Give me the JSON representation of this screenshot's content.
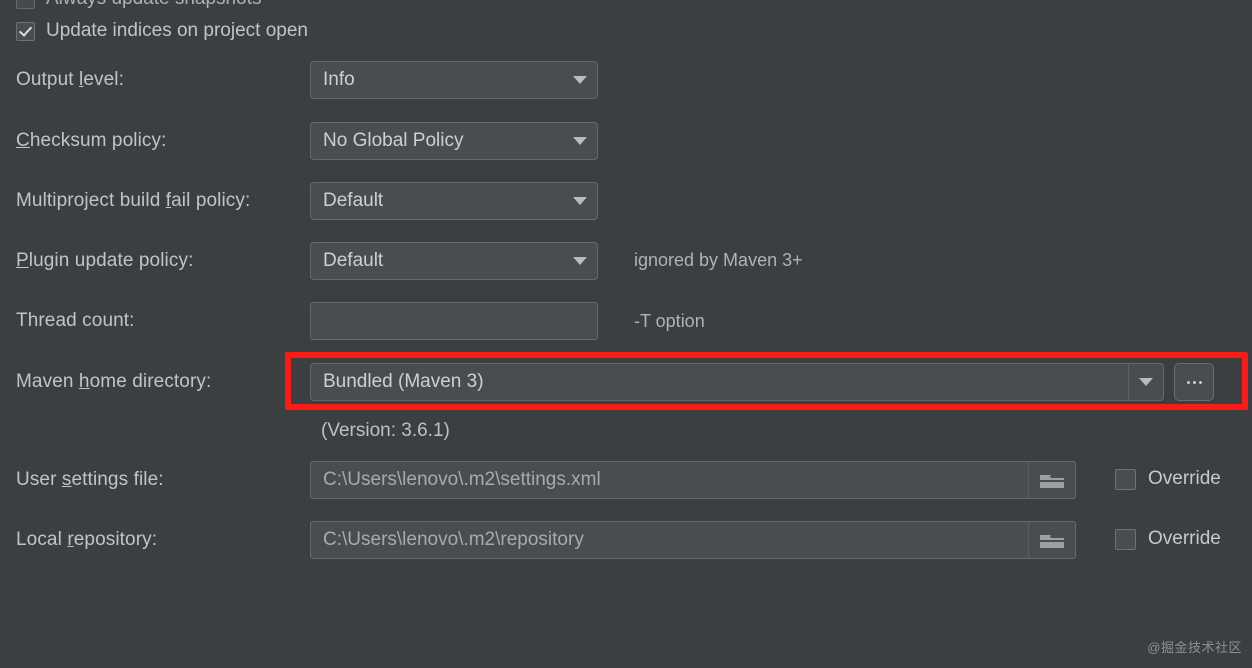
{
  "theme": {
    "background": "#3c3f41",
    "field_background": "#4a4d4f",
    "border": "#65696b",
    "text": "#c3c3c3",
    "muted_text": "#a9a9a9",
    "highlight": "#fc1a15"
  },
  "clipped_top_row": {
    "label": "Always update snapshots",
    "checked": false
  },
  "checkbox_row": {
    "label_before": "Update indices on project open",
    "label": "Update indices on project open",
    "checked": true,
    "icon": "checkbox-checked-icon"
  },
  "rows": [
    {
      "label_prefix": "Output ",
      "label_mnemonic": "l",
      "label_suffix": "evel:",
      "control": "combo",
      "value": "Info",
      "hint": ""
    },
    {
      "label_prefix": "",
      "label_mnemonic": "C",
      "label_suffix": "hecksum policy:",
      "control": "combo",
      "value": "No Global Policy",
      "hint": ""
    },
    {
      "label_prefix": "Multiproject build ",
      "label_mnemonic": "f",
      "label_suffix": "ail policy:",
      "control": "combo",
      "value": "Default",
      "hint": ""
    },
    {
      "label_prefix": "",
      "label_mnemonic": "P",
      "label_suffix": "lugin update policy:",
      "control": "combo",
      "value": "Default",
      "hint": "ignored by Maven 3+"
    },
    {
      "label_prefix": "Thread count:",
      "label_mnemonic": "",
      "label_suffix": "",
      "control": "text",
      "value": "",
      "hint": "-T option"
    }
  ],
  "maven_home": {
    "label_prefix": "Maven ",
    "label_mnemonic": "h",
    "label_suffix": "ome directory:",
    "value": "Bundled (Maven 3)",
    "caret_icon": "chevron-down-icon",
    "browse_label": "...",
    "browse_icon": "ellipsis-icon",
    "version_note": "(Version: 3.6.1)",
    "highlighted": true
  },
  "path_rows": [
    {
      "label_prefix": "User ",
      "label_mnemonic": "s",
      "label_suffix": "ettings file:",
      "value": "C:\\Users\\lenovo\\.m2\\settings.xml",
      "folder_icon": "folder-icon",
      "override_label": "Override",
      "override_checked": false
    },
    {
      "label_prefix": "Local ",
      "label_mnemonic": "r",
      "label_suffix": "epository:",
      "value": "C:\\Users\\lenovo\\.m2\\repository",
      "folder_icon": "folder-icon",
      "override_label": "Override",
      "override_checked": false
    }
  ],
  "watermark": {
    "text": "@掘金技术社区"
  }
}
